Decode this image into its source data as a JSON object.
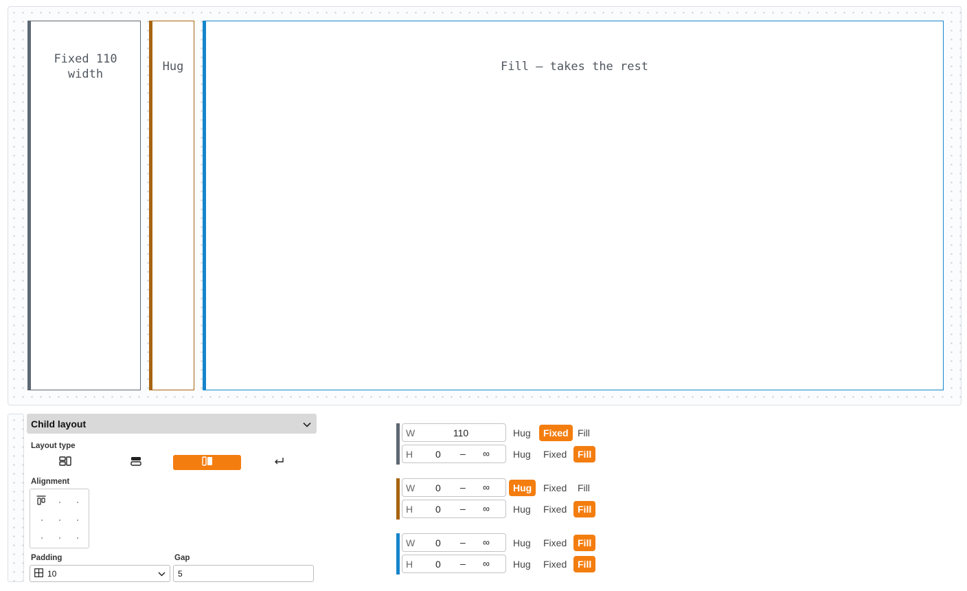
{
  "canvas": {
    "frames": [
      {
        "label": "Fixed 110 width",
        "color": "#5d6873"
      },
      {
        "label": "Hug",
        "color": "#a7640f"
      },
      {
        "label": "Fill — takes the rest",
        "color": "#1685cc"
      }
    ]
  },
  "panel": {
    "title": "Child layout",
    "layout_type_label": "Layout type",
    "layout_type_options": [
      "grid-icon",
      "rows-icon",
      "columns-icon",
      "wrap-icon"
    ],
    "layout_type_selected": "columns-icon",
    "alignment_label": "Alignment",
    "alignment_selected": "top-left",
    "padding_label": "Padding",
    "padding_value": "10",
    "gap_label": "Gap",
    "gap_value": "5"
  },
  "sizers": [
    {
      "color": "#5d6873",
      "width": {
        "axis": "W",
        "value": "110",
        "mode": "Fixed"
      },
      "height": {
        "axis": "H",
        "min": "0",
        "sep": "–",
        "max": "∞",
        "mode": "Fill"
      }
    },
    {
      "color": "#a7640f",
      "width": {
        "axis": "W",
        "min": "0",
        "sep": "–",
        "max": "∞",
        "mode": "Hug"
      },
      "height": {
        "axis": "H",
        "min": "0",
        "sep": "–",
        "max": "∞",
        "mode": "Fill"
      }
    },
    {
      "color": "#1685cc",
      "width": {
        "axis": "W",
        "min": "0",
        "sep": "–",
        "max": "∞",
        "mode": "Fill"
      },
      "height": {
        "axis": "H",
        "min": "0",
        "sep": "–",
        "max": "∞",
        "mode": "Fill"
      }
    }
  ],
  "mode_labels": {
    "hug": "Hug",
    "fixed": "Fixed",
    "fill": "Fill"
  },
  "accent": "#f47d0f"
}
